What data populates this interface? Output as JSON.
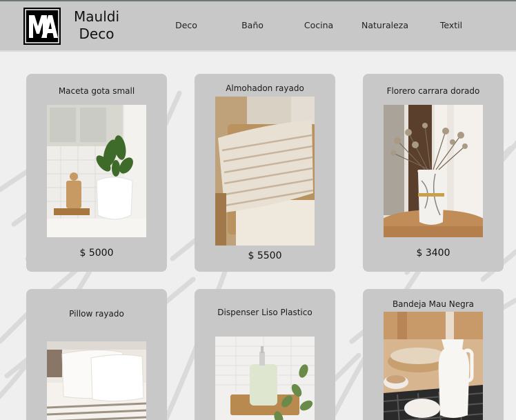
{
  "brand": {
    "line1": "Mauldi",
    "line2": "Deco",
    "logo_text": "MA"
  },
  "nav": [
    "Deco",
    "Baño",
    "Cocina",
    "Naturaleza",
    "Textil"
  ],
  "products": [
    {
      "name": "Maceta gota small",
      "price": "$ 5000"
    },
    {
      "name": "Almohadon rayado",
      "price": "$ 5500"
    },
    {
      "name": "Florero carrara dorado",
      "price": "$ 3400"
    },
    {
      "name": "Pillow rayado",
      "price": ""
    },
    {
      "name": "Dispenser Liso Plastico",
      "price": ""
    },
    {
      "name": "Bandeja Mau Negra",
      "price": ""
    }
  ]
}
